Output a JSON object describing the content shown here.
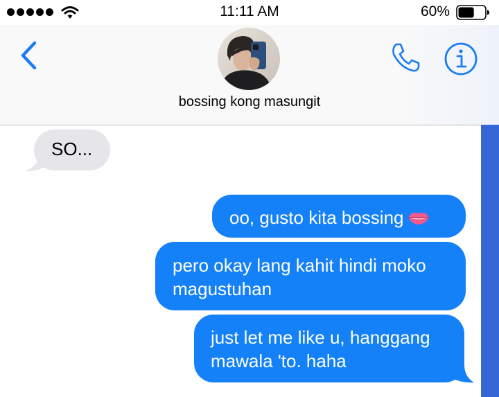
{
  "status_bar": {
    "time": "11:11 AM",
    "battery_percent": "60%",
    "battery_level": 0.6,
    "signal_icon": "signal-dots-icon",
    "wifi_icon": "wifi-icon"
  },
  "header": {
    "back_icon": "chevron-left-icon",
    "contact_name": "bossing kong masungit",
    "call_icon": "phone-icon",
    "info_icon": "info-icon"
  },
  "messages": [
    {
      "direction": "received",
      "text": "SO..."
    },
    {
      "direction": "sent",
      "text": "oo, gusto kita bossing",
      "emoji": "lips-icon"
    },
    {
      "direction": "sent",
      "text": "pero okay lang kahit hindi moko magustuhan"
    },
    {
      "direction": "sent",
      "text": "just let me like u, hanggang mawala 'to. haha"
    }
  ],
  "colors": {
    "accent": "#1a7cf5",
    "sent_bubble": "#1481f8",
    "received_bubble": "#e5e5ea",
    "scrollbar": "#3567d6"
  }
}
